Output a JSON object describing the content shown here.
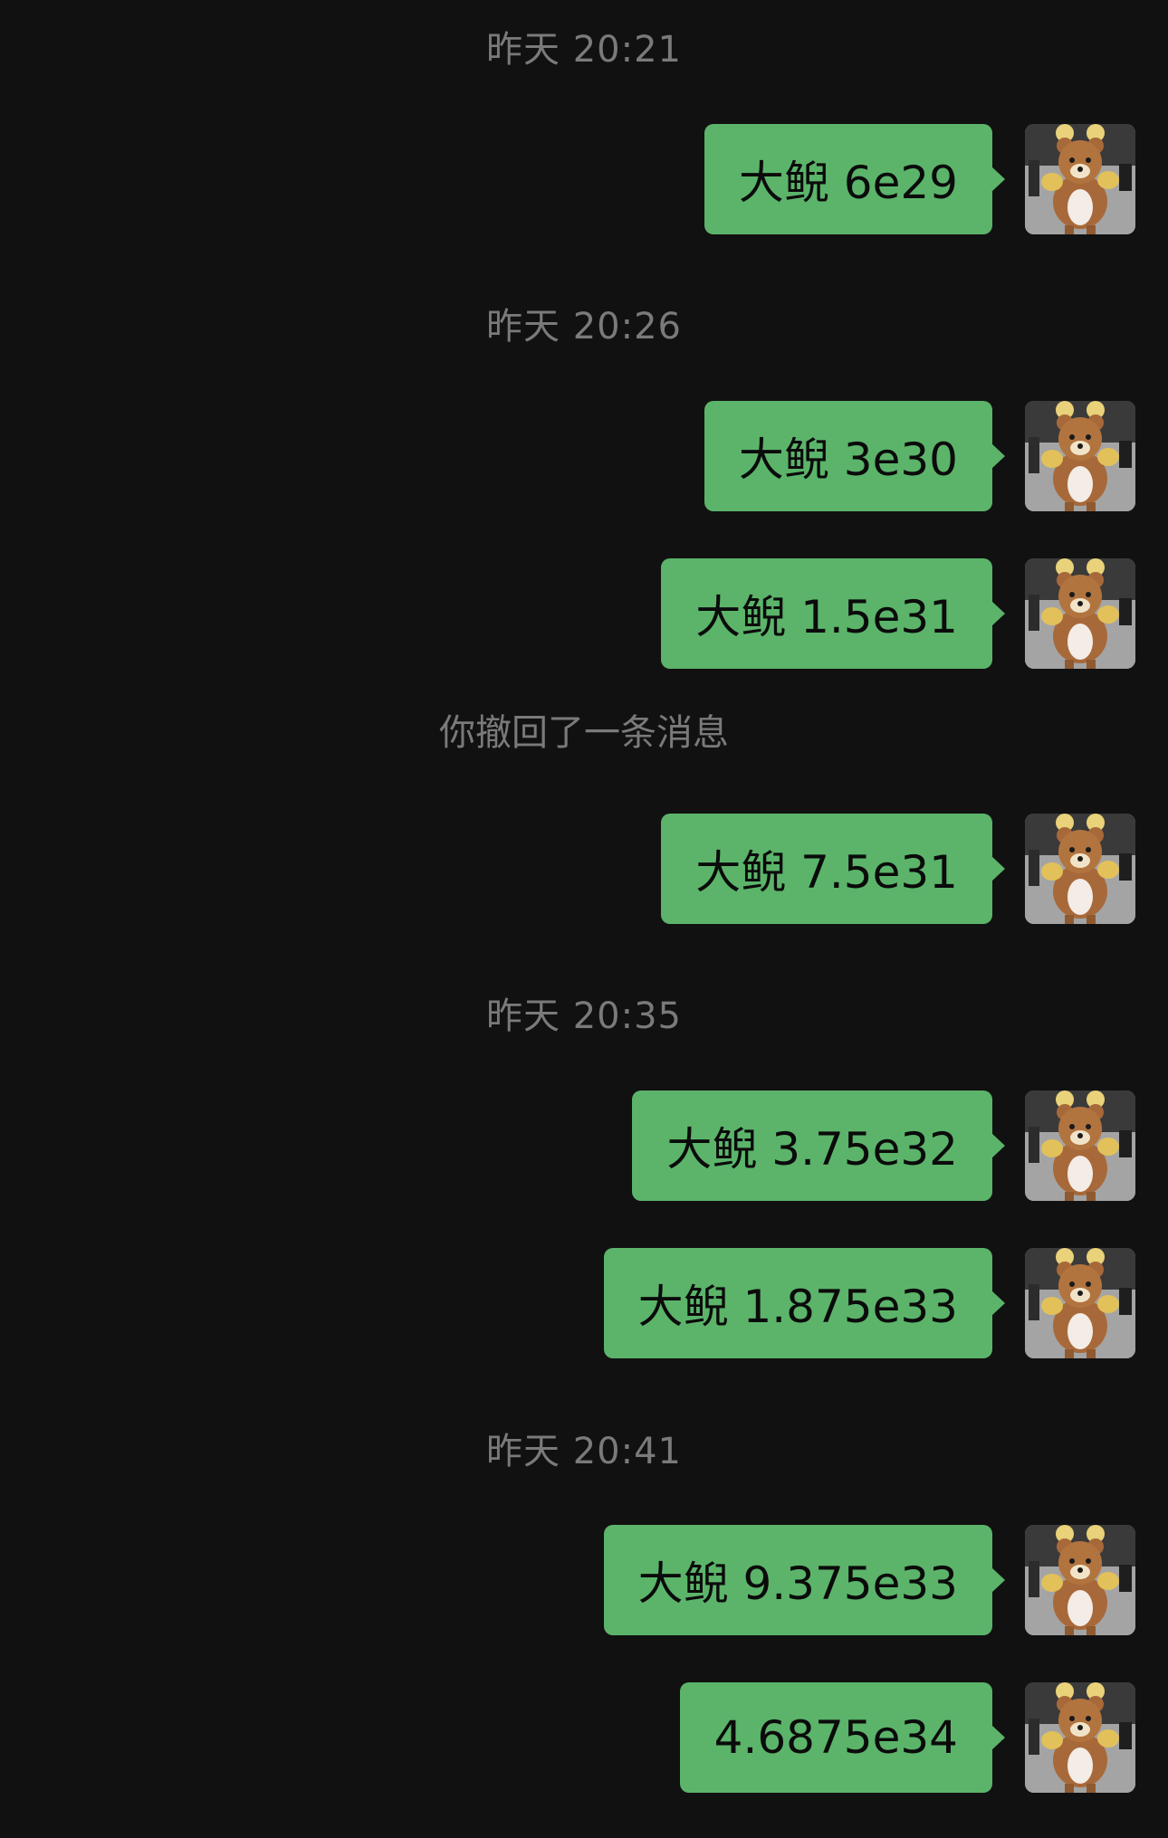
{
  "chat": {
    "events": [
      {
        "kind": "time",
        "text": "昨天 20:21"
      },
      {
        "kind": "msg",
        "text": "大鲵 6e29",
        "avatar": "rilakkuma-bear-avatar"
      },
      {
        "kind": "time",
        "text": "昨天 20:26"
      },
      {
        "kind": "msg",
        "text": "大鲵 3e30",
        "avatar": "rilakkuma-bear-avatar"
      },
      {
        "kind": "msg",
        "text": "大鲵 1.5e31",
        "avatar": "rilakkuma-bear-avatar"
      },
      {
        "kind": "system",
        "text": "你撤回了一条消息"
      },
      {
        "kind": "msg",
        "text": "大鲵 7.5e31",
        "avatar": "rilakkuma-bear-avatar"
      },
      {
        "kind": "time",
        "text": "昨天 20:35"
      },
      {
        "kind": "msg",
        "text": "大鲵 3.75e32",
        "avatar": "rilakkuma-bear-avatar"
      },
      {
        "kind": "msg",
        "text": "大鲵 1.875e33",
        "avatar": "rilakkuma-bear-avatar"
      },
      {
        "kind": "time",
        "text": "昨天 20:41"
      },
      {
        "kind": "msg",
        "text": "大鲵 9.375e33",
        "avatar": "rilakkuma-bear-avatar"
      },
      {
        "kind": "msg",
        "text": "4.6875e34",
        "avatar": "rilakkuma-bear-avatar"
      }
    ]
  },
  "colors": {
    "background": "#111111",
    "bubble": "#5bb46a",
    "timestamp_text": "#7a7a7a",
    "bubble_text": "#0b0b0b"
  }
}
